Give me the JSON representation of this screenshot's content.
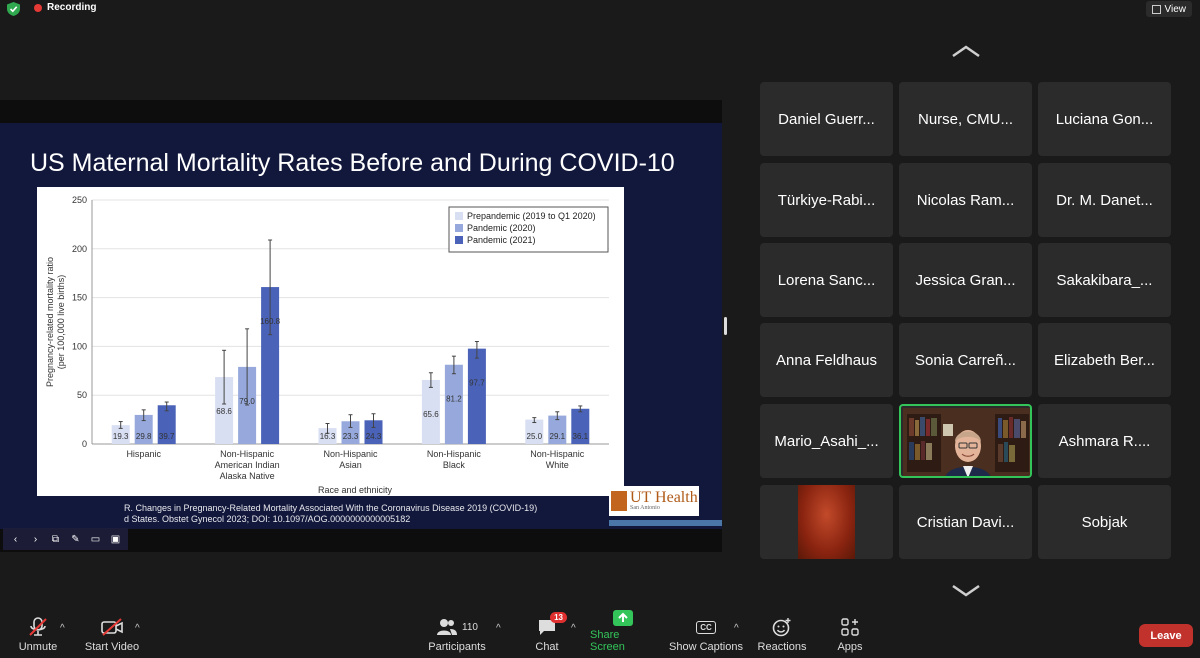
{
  "top_bar": {
    "recording_label": "Recording",
    "view_label": "View"
  },
  "slide": {
    "title": "US Maternal Mortality Rates Before and During COVID-10",
    "footnote_line1": "R. Changes in Pregnancy-Related Mortality Associated With the Coronavirus Disease 2019 (COVID-19)",
    "footnote_line2": "d States. Obstet Gynecol 2023; DOI: 10.1097/AOG.0000000000005182",
    "logo_text": "UT Health",
    "logo_sub": "San Antonio"
  },
  "chart_data": {
    "type": "bar",
    "ylabel": "Pregnancy-related mortality ratio (per 100,000 live births)",
    "ylabel_line1": "Pregnancy-related mortality ratio",
    "ylabel_line2": "(per 100,000 live births)",
    "xlabel": "Race and ethnicity",
    "ylim": [
      0,
      250
    ],
    "yticks": [
      0,
      50,
      100,
      150,
      200,
      250
    ],
    "grid": true,
    "legend_position": "top-right",
    "categories": [
      [
        "Hispanic"
      ],
      [
        "Non-Hispanic",
        "American Indian",
        "Alaska Native"
      ],
      [
        "Non-Hispanic",
        "Asian"
      ],
      [
        "Non-Hispanic",
        "Black"
      ],
      [
        "Non-Hispanic",
        "White"
      ]
    ],
    "series": [
      {
        "name": "Prepandemic (2019 to Q1 2020)",
        "color": "#d9dff2",
        "values": [
          19.3,
          68.6,
          16.3,
          65.6,
          25.0
        ],
        "labels": [
          "19.3",
          "68.6",
          "16.3",
          "65.6",
          "25.0"
        ],
        "error": [
          [
            16,
            23
          ],
          [
            41,
            96
          ],
          [
            11,
            21
          ],
          [
            58,
            73
          ],
          [
            22,
            27
          ]
        ]
      },
      {
        "name": "Pandemic (2020)",
        "color": "#97a9dc",
        "values": [
          29.8,
          79.0,
          23.3,
          81.2,
          29.1
        ],
        "labels": [
          "29.8",
          "79.0",
          "23.3",
          "81.2",
          "29.1"
        ],
        "error": [
          [
            24,
            35
          ],
          [
            40,
            118
          ],
          [
            17,
            30
          ],
          [
            72,
            90
          ],
          [
            25,
            33
          ]
        ]
      },
      {
        "name": "Pandemic (2021)",
        "color": "#4a63b8",
        "values": [
          39.7,
          160.8,
          24.3,
          97.7,
          36.1
        ],
        "labels": [
          "39.7",
          "160.8",
          "24.3",
          "97.7",
          "36.1"
        ],
        "error": [
          [
            34,
            43
          ],
          [
            112,
            209
          ],
          [
            17,
            31
          ],
          [
            88,
            105
          ],
          [
            33,
            39
          ]
        ]
      }
    ]
  },
  "participants": [
    "Daniel Guerr...",
    "Nurse, CMU...",
    "Luciana Gon...",
    "Türkiye-Rabi...",
    "Nicolas Ram...",
    "Dr. M. Danet...",
    "Lorena Sanc...",
    "Jessica Gran...",
    "Sakakibara_...",
    "Anna Feldhaus",
    "Sonia Carreñ...",
    "Elizabeth Ber...",
    "Mario_Asahi_...",
    "",
    "Ashmara R....",
    "",
    "Cristian Davi...",
    "Sobjak"
  ],
  "toolbar": {
    "unmute": "Unmute",
    "start_video": "Start Video",
    "participants": "Participants",
    "participant_count": "110",
    "chat": "Chat",
    "chat_badge": "13",
    "share_screen": "Share Screen",
    "show_captions": "Show Captions",
    "cc": "CC",
    "reactions": "Reactions",
    "apps": "Apps",
    "leave": "Leave"
  },
  "colors": {
    "share_green": "#33c55a",
    "leave_red": "#c1322d",
    "recording_red": "#e53935"
  }
}
